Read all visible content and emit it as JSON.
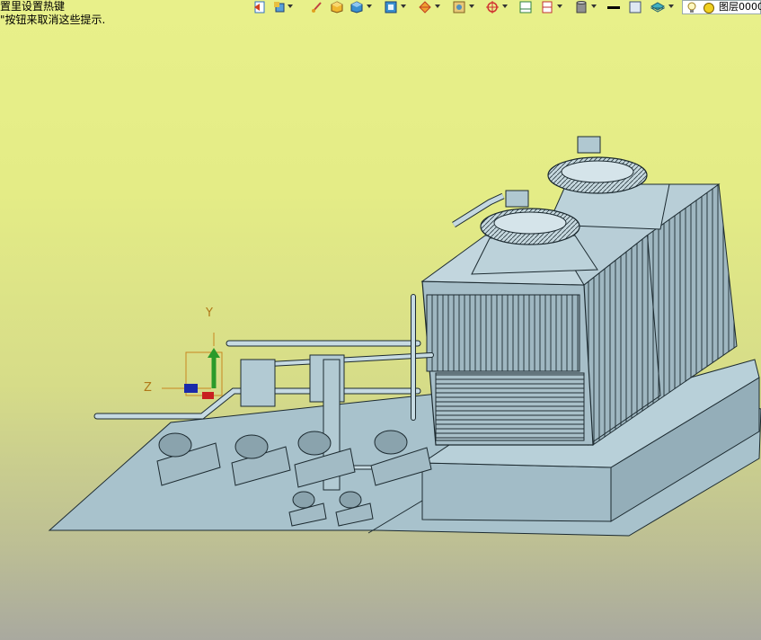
{
  "hint_lines": [
    "置里设置热键",
    "\"按钮来取消这些提示."
  ],
  "layer": {
    "label": "图层0000"
  },
  "triad": {
    "y": "Y",
    "z": "Z"
  },
  "toolbar_icons": [
    "exit-icon",
    "paint-bucket-icon",
    "sketch-pen-icon",
    "box-solid-icon",
    "cube-view-icon",
    "render-mode-icon",
    "sphere-wire-icon",
    "image-display-icon",
    "snap-target-icon",
    "frame-icon",
    "split-view-icon",
    "database-icon",
    "line-color-icon",
    "fill-color-icon",
    "layer-stack-icon",
    "lightbulb-icon",
    "layer-status-icon"
  ],
  "colors": {
    "model_fill": "#b4ccd6",
    "model_edge": "#1c2a30",
    "bg_top": "#e8f08a",
    "bg_bottom": "#a9a99f"
  }
}
